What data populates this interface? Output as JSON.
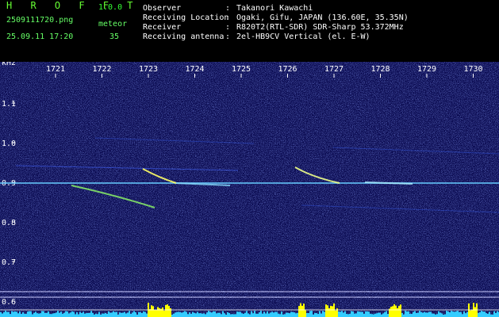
{
  "header": {
    "app_title": "H R O F F T",
    "app_version": "1.0.0",
    "file_name": "2509111720.png",
    "meteor_label": "meteor",
    "datetime": "25.09.11 17:20",
    "meteor_count": "35",
    "info": [
      {
        "label": "Observer",
        "value": "Takanori Kawachi"
      },
      {
        "label": "Receiving Location",
        "value": "Ogaki, Gifu, JAPAN (136.60E, 35.35N)"
      },
      {
        "label": "Receiver",
        "value": "R820T2(RTL-SDR) SDR-Sharp 53.372MHz"
      },
      {
        "label": "Receiving antenna",
        "value": "2el-HB9CV Vertical (el. E-W)"
      }
    ]
  },
  "spectrogram": {
    "y_unit": "kHz",
    "y_ticks": [
      "1.1",
      "1.0",
      "0.9",
      "0.8",
      "0.7",
      "0.6"
    ],
    "x_ticks": [
      "1721",
      "1722",
      "1723",
      "1724",
      "1725",
      "1726",
      "1727",
      "1728",
      "1729",
      "1730"
    ],
    "colors": {
      "background": "#0a0a50",
      "carrier": "#66ccff",
      "meteor": "#ffff66",
      "level_bar": "#33ccff",
      "level_peak": "#ffff00"
    }
  }
}
